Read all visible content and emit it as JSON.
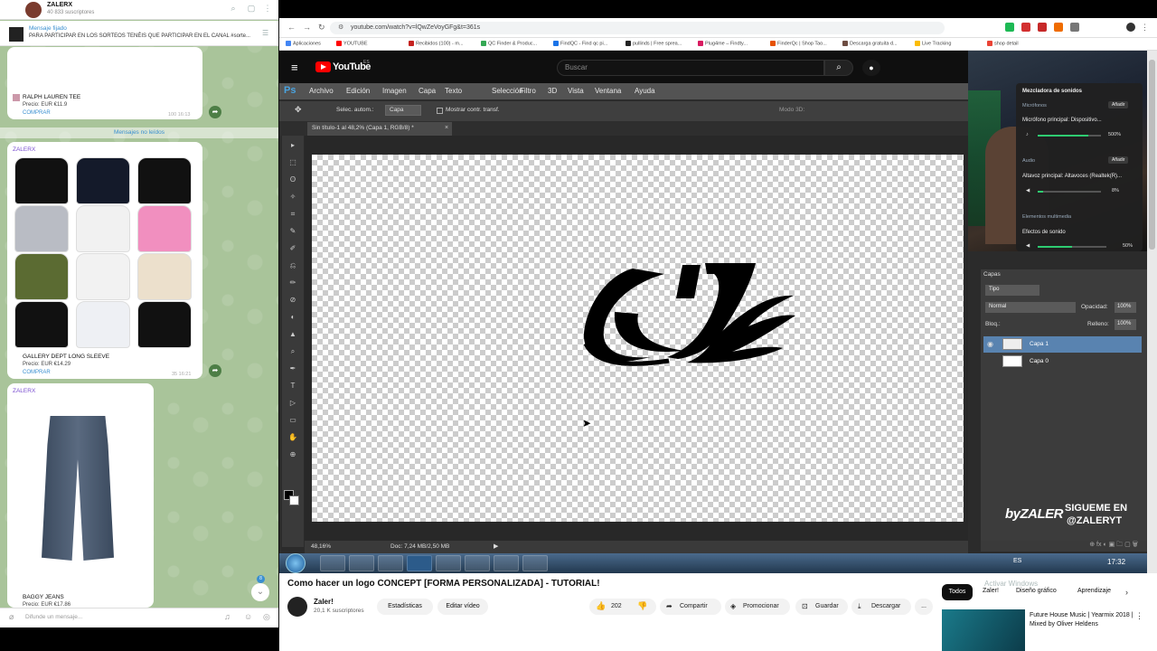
{
  "telegram": {
    "channel_title": "ZALERX",
    "subscribers": "40 833 suscriptores",
    "pinned_label": "Mensaje fijado",
    "pinned_text": "PARA PARTICIPAR EN LOS SORTEOS TENÉIS QUE PARTICIPAR EN EL CANAL #sorte...",
    "msg1": {
      "name": "RALPH LAUREN TEE",
      "price": "Precio: EUR €11.9",
      "buy": "COMPRAR",
      "meta": "100  16:13"
    },
    "unread_label": "Mensajes no leídos",
    "msg2": {
      "sender": "ZALERX",
      "name": "GALLERY DEPT LONG SLEEVE",
      "price": "Precio: EUR €14.29",
      "buy": "COMPRAR",
      "meta": "35  16:21",
      "shirt_colors": [
        "#111111",
        "#141a2a",
        "#111111",
        "#b9bcc4",
        "#f1f1f1",
        "#f18fbf",
        "#5b6b32",
        "#f2f2f2",
        "#ece0cc",
        "#111111",
        "#eef0f4",
        "#111111"
      ]
    },
    "msg3": {
      "sender": "ZALERX",
      "name": "BAGGY JEANS",
      "price": "Precio: EUR €17.86"
    },
    "down_badge": "8",
    "input_placeholder": "Difunde un mensaje..."
  },
  "browser": {
    "url": "youtube.com/watch?v=lQwZeVoyGFg&t=361s",
    "bookmarks": [
      "Aplicaciones",
      "YOUTUBE",
      "Recibidos (100) - m...",
      "QC Finder & Produc...",
      "FindQC - Find qc pi...",
      "pullinds | Free sprea...",
      "Plug4me – Findty...",
      "FinderQc | Shop Tao...",
      "Descarga gratuita d...",
      "Live Tracking",
      "shop detail"
    ]
  },
  "youtube_header": {
    "logo": "YouTube",
    "country": "ES",
    "search_placeholder": "Buscar"
  },
  "photoshop": {
    "logo": "Ps",
    "menus": [
      "Archivo",
      "Edición",
      "Imagen",
      "Capa",
      "Texto",
      "Selección",
      "Filtro",
      "3D",
      "Vista",
      "Ventana",
      "Ayuda"
    ],
    "options": {
      "auto_select": "Selec. autom.:",
      "auto_select_value": "Capa",
      "show_transform": "Mostrar contr. transf.",
      "mode3d": "Modo 3D:"
    },
    "doc_tab": "Sin título-1 al 48,2% (Capa 1, RGB/8) *",
    "zoom": "48,16%",
    "doc_size": "Doc: 7,24 MB/2,50 MB",
    "layers": {
      "tab": "Capas",
      "kind": "Tipo",
      "mode": "Normal",
      "opacity_label": "Opacidad:",
      "opacity": "100%",
      "lock_label": "Bloq.:",
      "fill_label": "Relleno:",
      "fill": "100%",
      "items": [
        "Capa 1",
        "Capa 0"
      ]
    }
  },
  "mixer": {
    "title": "Mezcladora de sonidos",
    "mic_section": "Micrófonos",
    "add": "Añadir",
    "mic_name": "Micrófono principal: Dispositivo...",
    "mic_value": "500%",
    "mic_level": 0.8,
    "audio_section": "Audio",
    "audio_name": "Altavoz principal: Altavoces (Realtek(R)...",
    "audio_value": "8%",
    "audio_level": 0.08,
    "media_section": "Elementos multimedia",
    "effects_name": "Efectos de sonido",
    "effects_value": "50%",
    "effects_level": 0.5
  },
  "overlay": {
    "brand": "byZALER",
    "follow1": "SIGUEME EN",
    "follow2": "@ZALERYT"
  },
  "taskbar": {
    "lang": "ES",
    "time": "17:32"
  },
  "video": {
    "title": "Como hacer un logo CONCEPT [FORMA PERSONALIZADA] - TUTORIAL!",
    "channel": "Zaler!",
    "channel_subs": "20,1 K suscriptores",
    "buttons": {
      "stats": "Estadísticas",
      "edit": "Editar vídeo",
      "likes": "202",
      "share": "Compartir",
      "promote": "Promocionar",
      "save": "Guardar",
      "download": "Descargar",
      "more": "..."
    },
    "chips": [
      "Todos",
      "Zaler!",
      "Diseño gráfico",
      "Aprendizaje"
    ],
    "watermark": "Activar Windows",
    "rec_title": "Future House Music | Yearmix 2018 | Mixed by Oliver Heldens"
  }
}
